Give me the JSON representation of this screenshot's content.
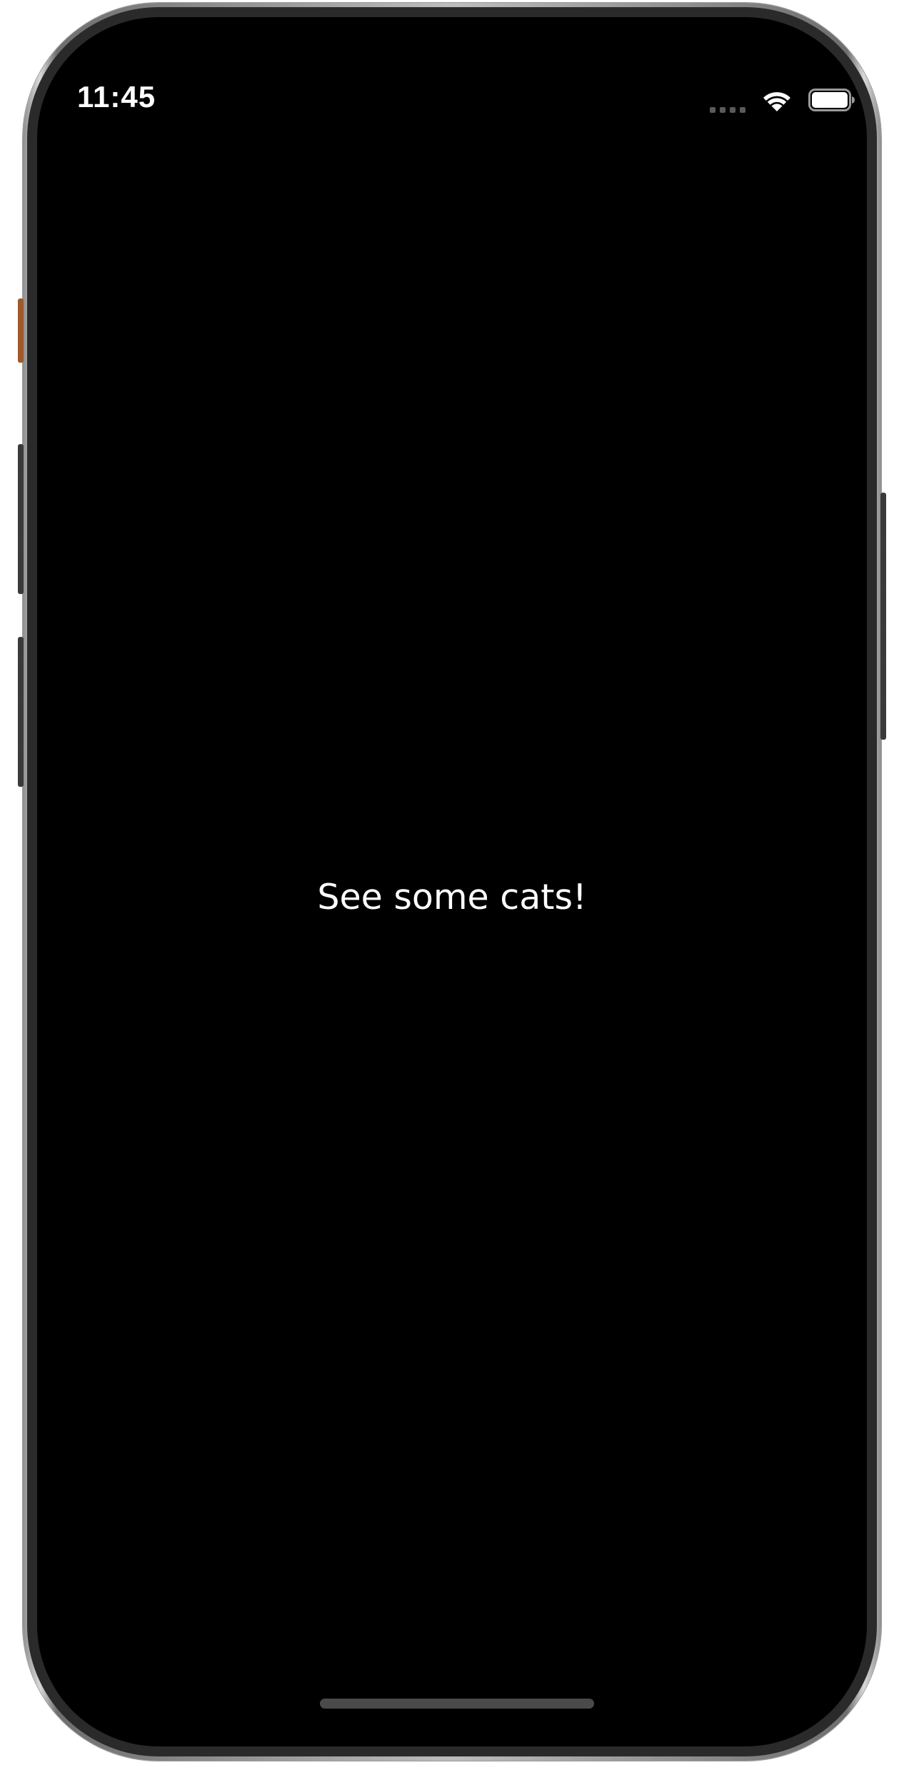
{
  "status_bar": {
    "time": "11:45",
    "icons": [
      "signal-icon",
      "wifi-icon",
      "battery-icon"
    ]
  },
  "main": {
    "label": "See some cats!"
  },
  "colors": {
    "screen_background": "#000000",
    "text": "#ffffff",
    "mute_switch": "#a0592b",
    "home_indicator": "#4a4a4a"
  }
}
